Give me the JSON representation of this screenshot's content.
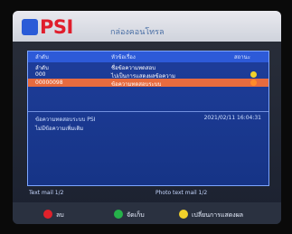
{
  "brand": {
    "logo_text": "PSI",
    "title": "กล่องคอนโทรล"
  },
  "table": {
    "headers": [
      "ลำดับ",
      "หัวข้อเรื่อง",
      "สถานะ"
    ],
    "rows": [
      {
        "c1": "ลำดับ",
        "c2": "ชื่อข้อความทดสอบ",
        "c3": ""
      },
      {
        "c1": "000",
        "c2": "ไปเป็นการแสดงผลข้อความ",
        "c3": ""
      },
      {
        "c1": "00000098",
        "c2": "ข้อความทดสอบระบบ",
        "c3": ""
      }
    ],
    "colors": {
      "header_bg": "#2d5ad8",
      "row_selected_bg": "#e76b3f",
      "dot_yellow": "#f1d12b",
      "dot_orange": "#ff8b2a"
    }
  },
  "detail": {
    "title": "ข้อความทดสอบระบบ PSI",
    "timestamp": "2021/02/11 16:04:31",
    "body": "ไม่มีข้อความเพิ่มเติม"
  },
  "meta": {
    "left": "Text mail  1/2",
    "right": "Photo text mail  1/2"
  },
  "footer": {
    "red": "ลบ",
    "green": "จัดเก็บ",
    "yellow": "เปลี่ยนการแสดงผล",
    "colors": {
      "red": "#e0212b",
      "green": "#25b24a",
      "yellow": "#f1d12b"
    }
  }
}
